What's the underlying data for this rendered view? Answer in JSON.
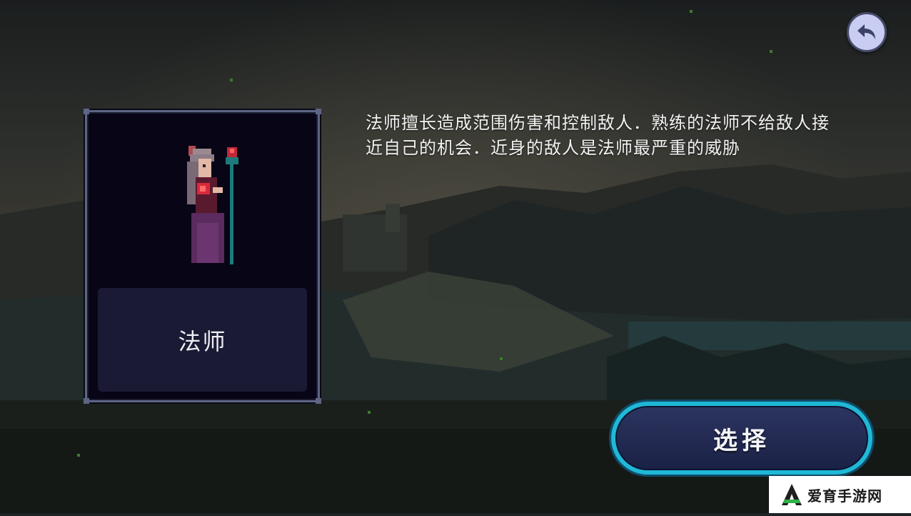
{
  "hero": {
    "name": "法师",
    "description": "法师擅长造成范围伤害和控制敌人．熟练的法师不给敌人接近自己的机会．近身的敌人是法师最严重的威胁",
    "portrait_icon": "mage-portrait-icon"
  },
  "actions": {
    "select_label": "选择",
    "back_icon": "back-arrow-icon"
  },
  "watermark": {
    "text": "爱育手游网"
  },
  "colors": {
    "accent_cyan": "#1fb8d6",
    "card_border": "#5d6586",
    "card_bg": "#070516",
    "name_plate_bg": "#1b1a35",
    "back_button_bg": "#c9cdf2"
  }
}
